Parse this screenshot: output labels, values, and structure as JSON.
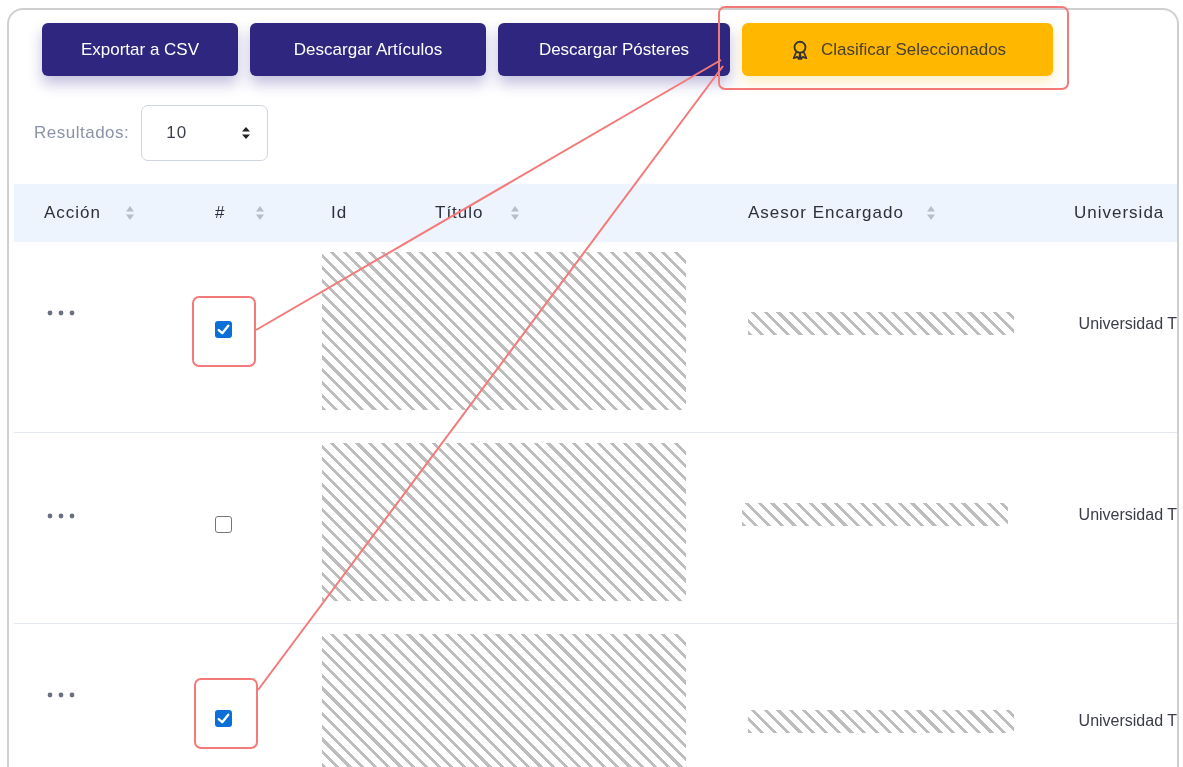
{
  "toolbar": {
    "buttons": [
      {
        "label": "Exportar a CSV",
        "kind": "primary"
      },
      {
        "label": "Descargar Artículos",
        "kind": "primary"
      },
      {
        "label": "Descargar Pósteres",
        "kind": "primary"
      },
      {
        "label": "Clasificar Seleccionados",
        "kind": "accent"
      }
    ]
  },
  "page_size": {
    "label": "Resultados:",
    "value": "10"
  },
  "table": {
    "columns": [
      {
        "label": "Acción",
        "sortable": true
      },
      {
        "label": "#",
        "sortable": true
      },
      {
        "label": "Id",
        "sortable": false
      },
      {
        "label": "Título",
        "sortable": true
      },
      {
        "label": "Asesor Encargado",
        "sortable": true
      },
      {
        "label": "Universida",
        "sortable": false
      }
    ],
    "rows": [
      {
        "checked": true,
        "university": "Universidad T"
      },
      {
        "checked": false,
        "university": "Universidad T"
      },
      {
        "checked": true,
        "university": "Universidad T"
      }
    ]
  }
}
